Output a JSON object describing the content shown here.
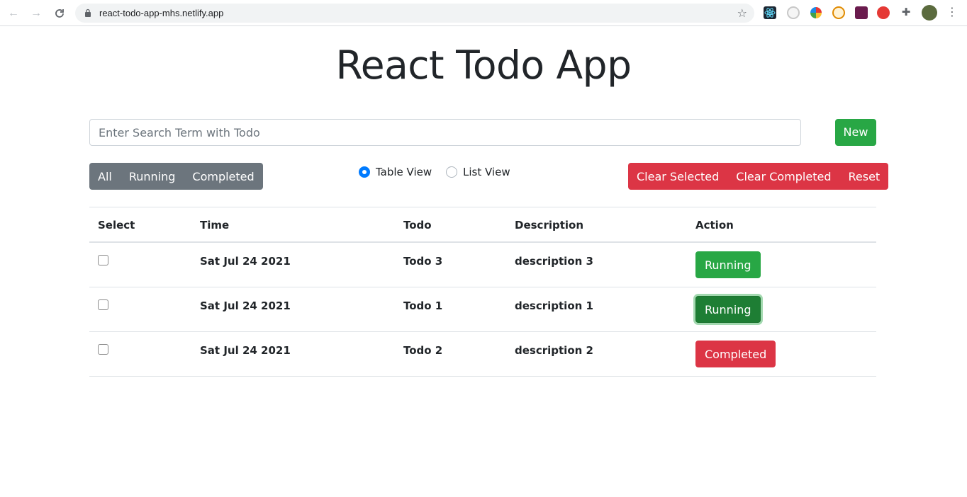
{
  "browser": {
    "url": "react-todo-app-mhs.netlify.app"
  },
  "page": {
    "title": "React Todo App"
  },
  "search": {
    "placeholder": "Enter Search Term with Todo"
  },
  "toolbar": {
    "new_label": "New",
    "filters": [
      "All",
      "Running",
      "Completed"
    ],
    "views": [
      {
        "label": "Table View",
        "checked": true
      },
      {
        "label": "List View",
        "checked": false
      }
    ],
    "clear_actions": [
      "Clear Selected",
      "Clear Completed",
      "Reset"
    ]
  },
  "table": {
    "headers": [
      "Select",
      "Time",
      "Todo",
      "Description",
      "Action"
    ],
    "rows": [
      {
        "time": "Sat Jul 24 2021",
        "todo": "Todo 3",
        "description": "description 3",
        "action": "Running",
        "status": "running"
      },
      {
        "time": "Sat Jul 24 2021",
        "todo": "Todo 1",
        "description": "description 1",
        "action": "Running",
        "status": "running-focus"
      },
      {
        "time": "Sat Jul 24 2021",
        "todo": "Todo 2",
        "description": "description 2",
        "action": "Completed",
        "status": "completed"
      }
    ]
  },
  "colors": {
    "success": "#28a745",
    "danger": "#dc3545",
    "secondary": "#6c757d",
    "primary": "#007bff"
  },
  "icons": {
    "back": "arrow-left-icon",
    "forward": "arrow-right-icon",
    "reload": "reload-icon",
    "lock": "lock-icon",
    "star": "star-icon",
    "menu": "kebab-menu-icon"
  }
}
